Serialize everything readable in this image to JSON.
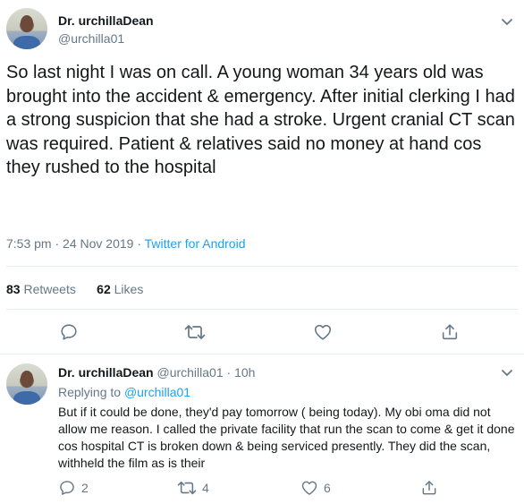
{
  "main_tweet": {
    "display_name": "Dr. urchillaDean",
    "handle": "@urchilla01",
    "text": "So last night I was on call. A young woman 34 years old was brought into the accident & emergency. After initial clerking I had a strong suspicion that she had a stroke. Urgent cranial CT scan was required. Patient & relatives said no money at hand cos they rushed to the hospital",
    "time": "7:53 pm",
    "date": "24 Nov 2019",
    "client": "Twitter for Android",
    "retweets_count": "83",
    "retweets_label": "Retweets",
    "likes_count": "62",
    "likes_label": "Likes"
  },
  "reply_tweet": {
    "display_name": "Dr. urchillaDean",
    "handle": "@urchilla01",
    "time_ago": "10h",
    "replying_to_label": "Replying to",
    "replying_to_handle": "@urchilla01",
    "text": "But if it could be done, they'd pay tomorrow ( being today). My obi oma did not allow me reason. I called the private facility that run the scan to come & get it done cos hospital CT is broken down & being serviced presently. They did the scan, withheld the film as is their",
    "reply_count": "2",
    "retweet_count": "4",
    "like_count": "6"
  },
  "icons": {
    "reply": "reply-icon",
    "retweet": "retweet-icon",
    "like": "heart-icon",
    "share": "share-icon",
    "more": "chevron-down-icon"
  },
  "colors": {
    "text": "#14171a",
    "secondary": "#657786",
    "link": "#1da1f2",
    "divider": "#e6ecf0"
  }
}
